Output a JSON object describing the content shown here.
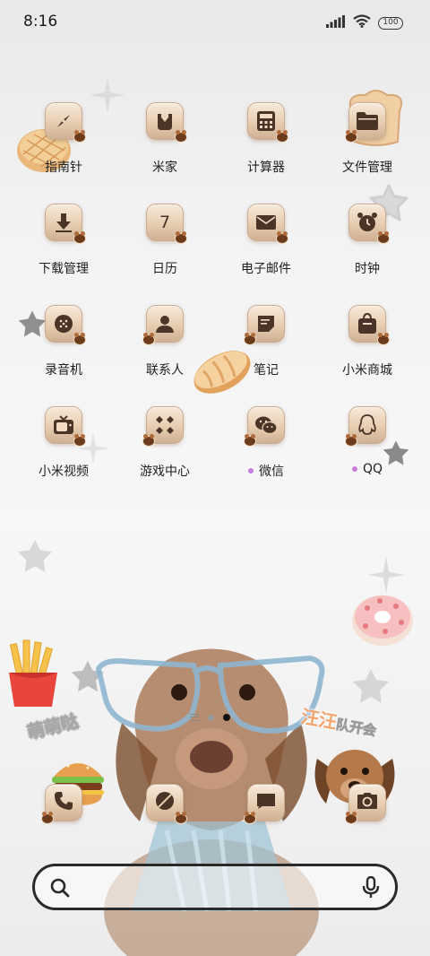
{
  "status_bar": {
    "time": "8:16",
    "battery": "100",
    "icons": [
      "signal-icon",
      "wifi-icon",
      "battery-icon"
    ]
  },
  "home": {
    "apps": [
      {
        "label": "指南针",
        "icon": "compass-icon"
      },
      {
        "label": "米家",
        "icon": "mijia-icon"
      },
      {
        "label": "计算器",
        "icon": "calculator-icon"
      },
      {
        "label": "文件管理",
        "icon": "folder-icon"
      },
      {
        "label": "下载管理",
        "icon": "download-icon"
      },
      {
        "label": "日历",
        "icon": "calendar-icon",
        "day": "7"
      },
      {
        "label": "电子邮件",
        "icon": "mail-icon"
      },
      {
        "label": "时钟",
        "icon": "alarm-clock-icon"
      },
      {
        "label": "录音机",
        "icon": "recorder-icon"
      },
      {
        "label": "联系人",
        "icon": "contacts-icon"
      },
      {
        "label": "笔记",
        "icon": "notes-icon"
      },
      {
        "label": "小米商城",
        "icon": "shopping-bag-icon"
      },
      {
        "label": "小米视频",
        "icon": "tv-icon"
      },
      {
        "label": "游戏中心",
        "icon": "game-icon"
      },
      {
        "label": "微信",
        "icon": "wechat-icon",
        "new_dot": true
      },
      {
        "label": "QQ",
        "icon": "qq-icon",
        "new_dot": true
      }
    ]
  },
  "wallpaper": {
    "sticker_left": "萌萌哒",
    "sticker_right_highlight": "汪汪",
    "sticker_right_rest": "队开会"
  },
  "dock": {
    "apps": [
      {
        "icon": "phone-icon"
      },
      {
        "icon": "browser-icon"
      },
      {
        "icon": "messages-icon"
      },
      {
        "icon": "camera-icon"
      }
    ]
  },
  "page_indicator": {
    "pages": 2,
    "active": 2
  },
  "search": {
    "placeholder": "",
    "value": ""
  },
  "colors": {
    "icon_bg": "#e7cdb1",
    "icon_glyph": "#4a3427",
    "new_dot": "#c77ddf",
    "search_border": "#2a2a2a"
  }
}
